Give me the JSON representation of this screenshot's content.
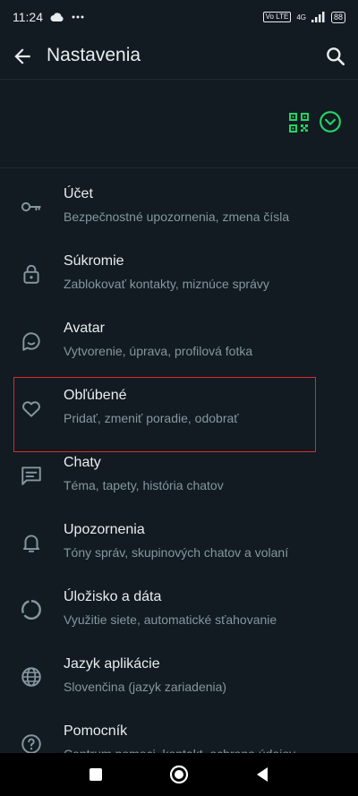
{
  "status": {
    "time": "11:24",
    "network": "4G",
    "lte": "Vo LTE",
    "battery": "88"
  },
  "header": {
    "title": "Nastavenia"
  },
  "colors": {
    "accent": "#25d366",
    "background": "#111b21",
    "highlight": "#e0262f"
  },
  "items": [
    {
      "title": "Účet",
      "subtitle": "Bezpečnostné upozornenia, zmena čísla",
      "icon": "key-icon"
    },
    {
      "title": "Súkromie",
      "subtitle": "Zablokovať kontakty, miznúce správy",
      "icon": "lock-icon"
    },
    {
      "title": "Avatar",
      "subtitle": "Vytvorenie, úprava, profilová fotka",
      "icon": "avatar-icon"
    },
    {
      "title": "Obľúbené",
      "subtitle": "Pridať, zmeniť poradie, odobrať",
      "icon": "heart-icon"
    },
    {
      "title": "Chaty",
      "subtitle": "Téma, tapety, história chatov",
      "icon": "chat-icon"
    },
    {
      "title": "Upozornenia",
      "subtitle": "Tóny správ, skupinových chatov a volaní",
      "icon": "bell-icon"
    },
    {
      "title": "Úložisko a dáta",
      "subtitle": "Využitie siete, automatické sťahovanie",
      "icon": "storage-icon"
    },
    {
      "title": "Jazyk aplikácie",
      "subtitle": "Slovenčina (jazyk zariadenia)",
      "icon": "globe-icon"
    },
    {
      "title": "Pomocník",
      "subtitle": "Centrum pomoci, kontakt, ochrana údajov",
      "icon": "help-icon"
    }
  ]
}
